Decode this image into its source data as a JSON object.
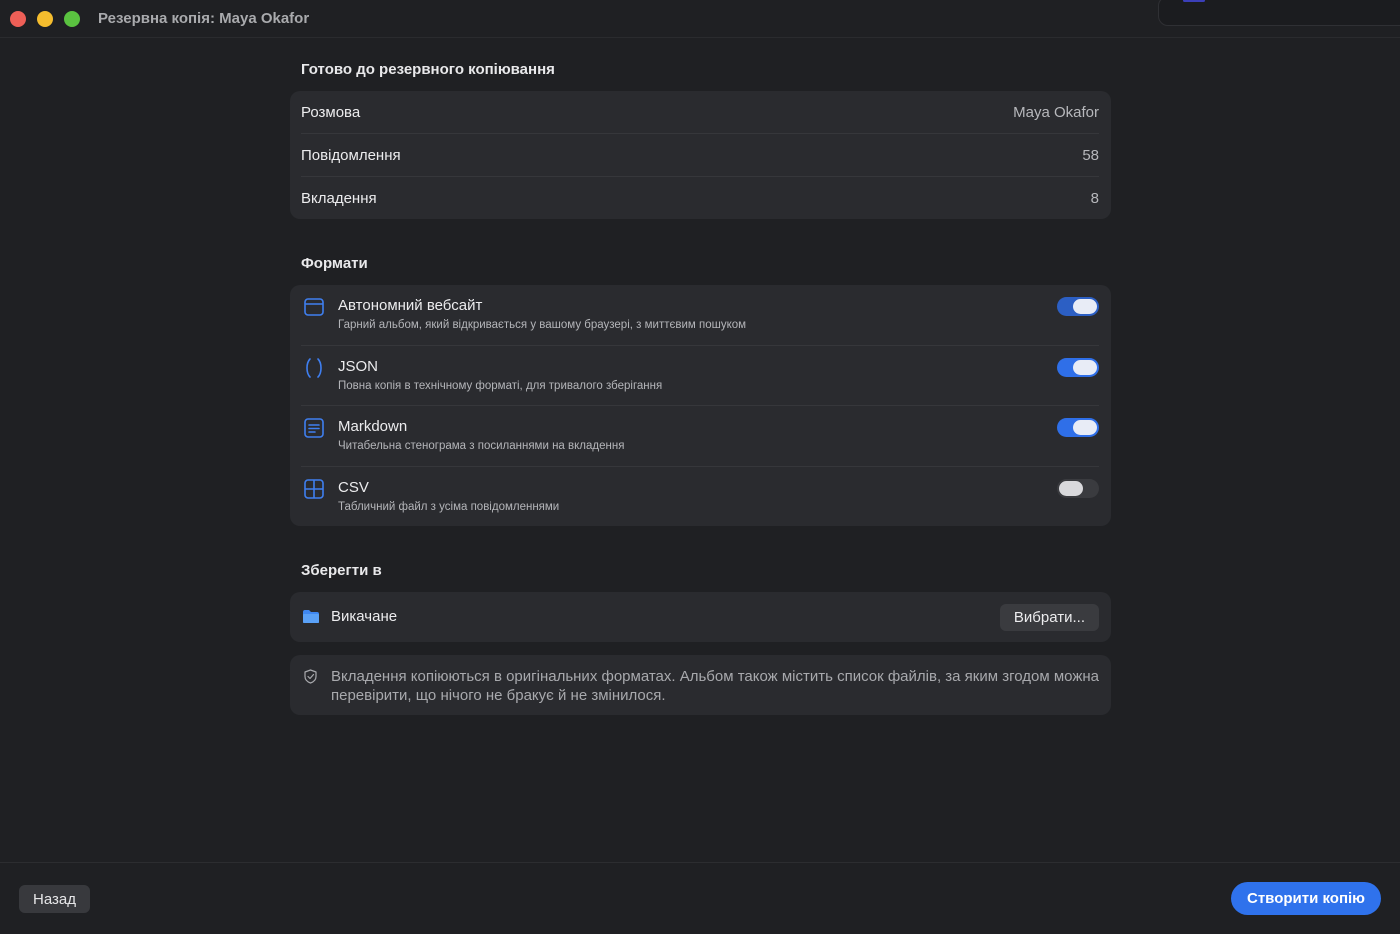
{
  "window": {
    "title": "Резервна копія: Maya Okafor"
  },
  "summary": {
    "heading": "Готово до резервного копіювання",
    "rows": [
      {
        "label": "Розмова",
        "value": "Maya Okafor"
      },
      {
        "label": "Повідомлення",
        "value": "58"
      },
      {
        "label": "Вкладення",
        "value": "8"
      }
    ]
  },
  "formats": {
    "heading": "Формати",
    "items": [
      {
        "name": "Автономний вебсайт",
        "description": "Гарний альбом, який відкривається у вашому браузері, з миттєвим пошуком",
        "icon": "browser-window-icon",
        "enabled": true
      },
      {
        "name": "JSON",
        "description": "Повна копія в технічному форматі, для тривалого зберігання",
        "icon": "braces-icon",
        "enabled": true
      },
      {
        "name": "Markdown",
        "description": "Читабельна стенограма з посиланнями на вкладення",
        "icon": "document-lines-icon",
        "enabled": true
      },
      {
        "name": "CSV",
        "description": "Табличний файл з усіма повідомленнями",
        "icon": "table-grid-icon",
        "enabled": false
      }
    ]
  },
  "save": {
    "heading": "Зберегти в",
    "folder": "Викачане",
    "choose_label": "Вибрати..."
  },
  "note": {
    "text": "Вкладення копіюються в оригінальних форматах. Альбом також містить список файлів, за яким згодом можна перевірити, що нічого не бракує й не змінилося."
  },
  "footer": {
    "back_label": "Назад",
    "create_label": "Створити копію"
  },
  "colors": {
    "accent": "#2f72ec",
    "icon_blue": "#3f7ff0",
    "background": "#1f2023",
    "card": "#2a2b2f"
  }
}
